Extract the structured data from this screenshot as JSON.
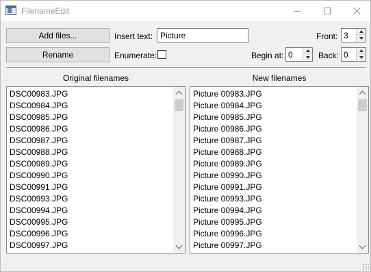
{
  "window": {
    "title": "FilenameEdit"
  },
  "controls": {
    "add_files_label": "Add files...",
    "rename_label": "Rename",
    "insert_text_label": "Insert text:",
    "insert_text_value": "Picture",
    "enumerate_label": "Enumerate:",
    "enumerate_checked": false,
    "front_label": "Front:",
    "front_value": "3",
    "begin_at_label": "Begin at:",
    "begin_at_value": "0",
    "back_label": "Back:",
    "back_value": "0"
  },
  "lists": {
    "original_header": "Original filenames",
    "new_header": "New filenames",
    "original": [
      "DSC00983.JPG",
      "DSC00984.JPG",
      "DSC00985.JPG",
      "DSC00986.JPG",
      "DSC00987.JPG",
      "DSC00988.JPG",
      "DSC00989.JPG",
      "DSC00990.JPG",
      "DSC00991.JPG",
      "DSC00993.JPG",
      "DSC00994.JPG",
      "DSC00995.JPG",
      "DSC00996.JPG",
      "DSC00997.JPG"
    ],
    "new": [
      "Picture 00983.JPG",
      "Picture 00984.JPG",
      "Picture 00985.JPG",
      "Picture 00986.JPG",
      "Picture 00987.JPG",
      "Picture 00988.JPG",
      "Picture 00989.JPG",
      "Picture 00990.JPG",
      "Picture 00991.JPG",
      "Picture 00993.JPG",
      "Picture 00994.JPG",
      "Picture 00995.JPG",
      "Picture 00996.JPG",
      "Picture 00997.JPG"
    ]
  }
}
